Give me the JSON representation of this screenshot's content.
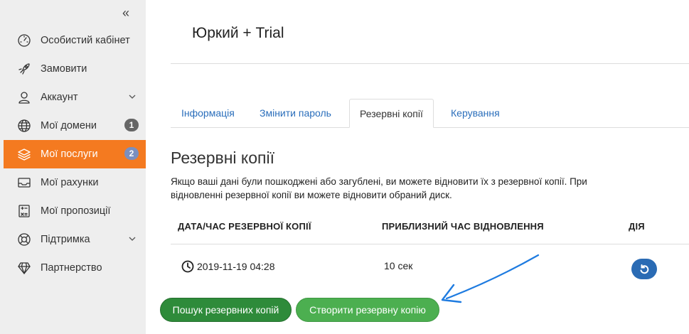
{
  "sidebar": {
    "collapse_icon": "«",
    "items": [
      {
        "label": "Особистий кабінет",
        "icon": "speedometer-icon"
      },
      {
        "label": "Замовити",
        "icon": "rocket-icon"
      },
      {
        "label": "Аккаунт",
        "icon": "user-icon",
        "expandable": true
      },
      {
        "label": "Мої домени",
        "icon": "globe-icon",
        "badge": "1"
      },
      {
        "label": "Мої послуги",
        "icon": "layers-icon",
        "badge": "2",
        "active": true
      },
      {
        "label": "Мої рахунки",
        "icon": "inbox-icon"
      },
      {
        "label": "Мої пропозиції",
        "icon": "calculator-icon"
      },
      {
        "label": "Підтримка",
        "icon": "lifebuoy-icon",
        "expandable": true
      },
      {
        "label": "Партнерство",
        "icon": "diamond-icon"
      }
    ]
  },
  "header": {
    "title": "Юркий + Trial"
  },
  "tabs": [
    {
      "label": "Інформація"
    },
    {
      "label": "Змінити пароль"
    },
    {
      "label": "Резервні копії",
      "active": true
    },
    {
      "label": "Керування"
    }
  ],
  "backups": {
    "title": "Резервні копії",
    "description": "Якщо ваші дані були пошкоджені або загублені, ви можете відновити їх з резервної копії. При відновленні резервної копії ви можете відновити обраний диск.",
    "columns": [
      "ДАТА/ЧАС РЕЗЕРВНОЇ КОПІЇ",
      "ПРИБЛИЗНИЙ ЧАС ВІДНОВЛЕННЯ",
      "ДІЯ"
    ],
    "rows": [
      {
        "datetime": "2019-11-19 04:28",
        "restore_time": "10 сек"
      }
    ],
    "search_button": "Пошук резервних копій",
    "create_button": "Створити резервну копію"
  },
  "colors": {
    "accent": "#f47a20",
    "link": "#2a6ebb",
    "primary_green": "#4caf50",
    "dark_green": "#2e8b3a",
    "annotation_arrow": "#1e7be0"
  }
}
